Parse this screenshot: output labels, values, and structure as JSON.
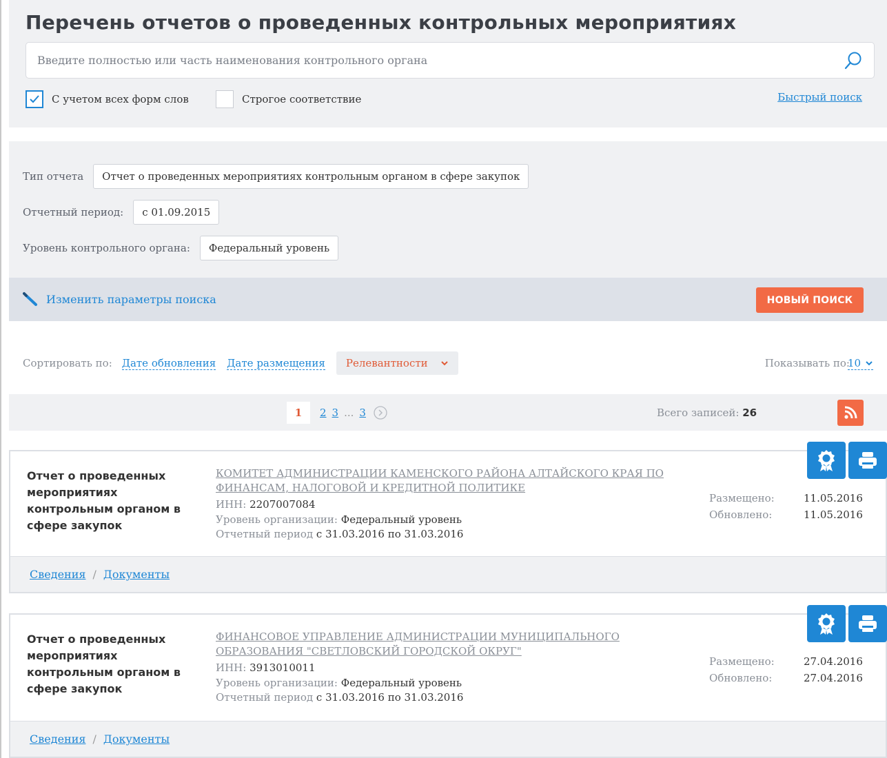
{
  "page_title": "Перечень отчетов о проведенных контрольных мероприятиях",
  "search": {
    "placeholder": "Введите полностью или часть наименования контрольного органа",
    "value": "",
    "morph_label": "С учетом всех форм слов",
    "morph_checked": true,
    "strict_label": "Строгое соответствие",
    "strict_checked": false,
    "quick_search": "Быстрый поиск"
  },
  "params": {
    "report_type_label": "Тип отчета",
    "report_type_value": "Отчет о проведенных мероприятиях контрольным органом в сфере закупок",
    "period_label": "Отчетный период:",
    "period_value": "с 01.09.2015",
    "level_label": "Уровень контрольного органа:",
    "level_value": "Федеральный уровень",
    "edit_link": "Изменить параметры поиска",
    "new_search": "НОВЫЙ ПОИСК"
  },
  "sort": {
    "label": "Сортировать по:",
    "by_update": "Дате обновления",
    "by_publish": "Дате размещения",
    "by_relevance": "Релевантности",
    "show_label": "Показывать по:",
    "show_value": "10"
  },
  "pager": {
    "current": "1",
    "pages": [
      "2",
      "3"
    ],
    "ellipsis": "...",
    "last": "3",
    "total_label": "Всего записей:",
    "total": "26"
  },
  "records": [
    {
      "type": "Отчет о проведенных мероприятиях контрольным органом в сфере закупок",
      "org": "КОМИТЕТ АДМИНИСТРАЦИИ КАМЕНСКОГО РАЙОНА АЛТАЙСКОГО КРАЯ ПО ФИНАНСАМ, НАЛОГОВОЙ И КРЕДИТНОЙ ПОЛИТИКЕ",
      "inn_label": "ИНН:",
      "inn": "2207007084",
      "level_label": "Уровень организации:",
      "level": "Федеральный уровень",
      "period_label": "Отчетный период",
      "period": "с 31.03.2016 по 31.03.2016",
      "published_label": "Размещено:",
      "published": "11.05.2016",
      "updated_label": "Обновлено:",
      "updated": "11.05.2016",
      "link_info": "Сведения",
      "link_docs": "Документы"
    },
    {
      "type": "Отчет о проведенных мероприятиях контрольным органом в сфере закупок",
      "org": "ФИНАНСОВОЕ УПРАВЛЕНИЕ АДМИНИСТРАЦИИ МУНИЦИПАЛЬНОГО ОБРАЗОВАНИЯ \"СВЕТЛОВСКИЙ ГОРОДСКОЙ ОКРУГ\"",
      "inn_label": "ИНН:",
      "inn": "3913010011",
      "level_label": "Уровень организации:",
      "level": "Федеральный уровень",
      "period_label": "Отчетный период",
      "period": "с 31.03.2016 по 31.03.2016",
      "published_label": "Размещено:",
      "published": "27.04.2016",
      "updated_label": "Обновлено:",
      "updated": "27.04.2016",
      "link_info": "Сведения",
      "link_docs": "Документы"
    }
  ],
  "colors": {
    "accent": "#1f87d5",
    "orange": "#f26a45",
    "panel": "#f0f1f3"
  }
}
